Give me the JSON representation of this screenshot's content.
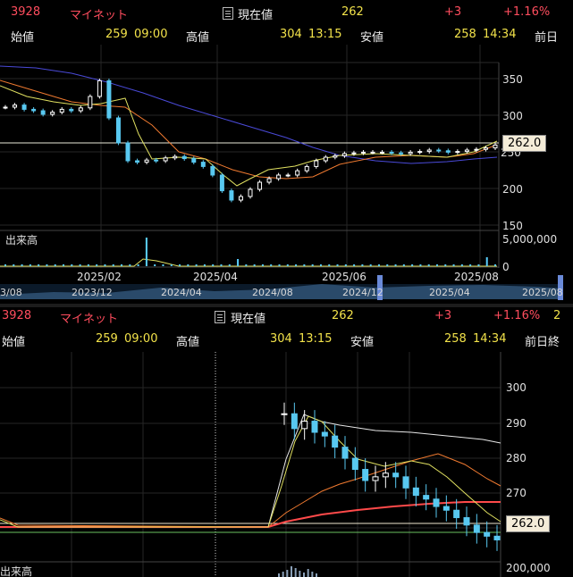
{
  "top_panel": {
    "code": "3928",
    "name": "マイネット",
    "current_label": "現在値",
    "current_value": "262",
    "change": "+3",
    "change_pct": "+1.16%",
    "open_label": "始値",
    "open_value": "259",
    "open_time": "09:00",
    "high_label": "高値",
    "high_value": "304",
    "high_time": "13:15",
    "low_label": "安値",
    "low_value": "258",
    "low_time": "14:34",
    "prev_label": "前日",
    "price_tag": "262.0",
    "volume_label": "出来高",
    "y_ticks": [
      "350",
      "300",
      "250",
      "200",
      "150"
    ],
    "vol_tick": "5,000,000",
    "vol_tick_zero": "0",
    "x_labels": [
      "2025/02",
      "2025/04",
      "2025/06",
      "2025/08"
    ],
    "overview_labels": [
      "3/08",
      "2023/12",
      "2024/04",
      "2024/08",
      "2024/12",
      "2025/04",
      "2025/08"
    ]
  },
  "bottom_panel": {
    "code": "3928",
    "name": "マイネット",
    "current_label": "現在値",
    "current_value": "262",
    "change": "+3",
    "change_pct": "+1.16%",
    "extra": "2",
    "open_label": "始値",
    "open_value": "259",
    "open_time": "09:00",
    "high_label": "高値",
    "high_value": "304",
    "high_time": "13:15",
    "low_label": "安値",
    "low_value": "258",
    "low_time": "14:34",
    "prev_label": "前日終",
    "price_tag": "262.0",
    "volume_label": "出来高",
    "y_ticks": [
      "300",
      "290",
      "280",
      "270"
    ],
    "vol_tick": "200,000"
  },
  "chart_data": [
    {
      "type": "candlestick",
      "title": "",
      "x_labels": [
        "2025/02",
        "2025/04",
        "2025/06",
        "2025/08"
      ],
      "y_ticks": [
        350,
        300,
        250,
        200,
        150
      ],
      "ylim": [
        150,
        365
      ],
      "current_price": 262.0,
      "close_approx": [
        315,
        318,
        312,
        310,
        305,
        308,
        312,
        310,
        314,
        330,
        352,
        300,
        265,
        240,
        238,
        241,
        240,
        244,
        246,
        243,
        238,
        232,
        220,
        198,
        185,
        190,
        200,
        210,
        215,
        220,
        220,
        226,
        232,
        240,
        245,
        247,
        250,
        251,
        252,
        252,
        252,
        251,
        250,
        252,
        253,
        255,
        254,
        252,
        253,
        255,
        256,
        258,
        262
      ]
    },
    {
      "type": "candlestick",
      "title": "",
      "y_ticks": [
        300,
        290,
        280,
        270
      ],
      "ylim": [
        265,
        304
      ],
      "current_price": 262.0,
      "close_approx": [
        296,
        292,
        294,
        291,
        290,
        287,
        284,
        281,
        278,
        279,
        280,
        279,
        276,
        274,
        273,
        271,
        270,
        268,
        266,
        264,
        263,
        262
      ]
    }
  ],
  "colors": {
    "up": "#ffffff",
    "down": "#58c8f0",
    "ma_short": "#e0e060",
    "ma_mid": "#f07a30",
    "ma_long": "#4a4ad8",
    "vol": "#5ad0ff",
    "grid": "#2a2a2a"
  }
}
